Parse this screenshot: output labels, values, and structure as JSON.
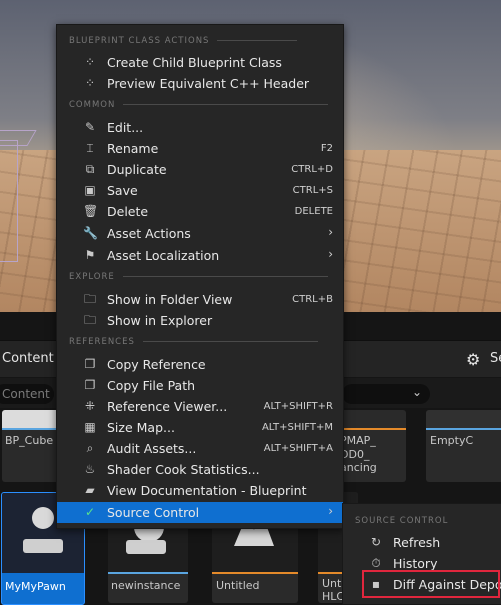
{
  "menu": {
    "sections": {
      "blueprint": "BLUEPRINT CLASS ACTIONS",
      "common": "COMMON",
      "explore": "EXPLORE",
      "references": "REFERENCES"
    },
    "items": {
      "create_child": {
        "label": "Create Child Blueprint Class",
        "icon": "blueprint-icon"
      },
      "preview_cpp": {
        "label": "Preview Equivalent C++ Header",
        "icon": "cpp-header-icon"
      },
      "edit": {
        "label": "Edit...",
        "icon": "pencil-icon"
      },
      "rename": {
        "label": "Rename",
        "shortcut": "F2",
        "icon": "rename-icon"
      },
      "duplicate": {
        "label": "Duplicate",
        "shortcut": "CTRL+D",
        "icon": "duplicate-icon"
      },
      "save": {
        "label": "Save",
        "shortcut": "CTRL+S",
        "icon": "save-icon"
      },
      "delete": {
        "label": "Delete",
        "shortcut": "DELETE",
        "icon": "trash-icon"
      },
      "asset_actions": {
        "label": "Asset Actions",
        "icon": "wrench-icon"
      },
      "asset_localization": {
        "label": "Asset Localization",
        "icon": "flag-icon"
      },
      "show_folder": {
        "label": "Show in Folder View",
        "shortcut": "CTRL+B",
        "icon": "folder-search-icon"
      },
      "show_explorer": {
        "label": "Show in Explorer",
        "icon": "folder-search-icon"
      },
      "copy_reference": {
        "label": "Copy Reference",
        "icon": "copy-icon"
      },
      "copy_file_path": {
        "label": "Copy File Path",
        "icon": "copy-icon"
      },
      "reference_viewer": {
        "label": "Reference Viewer...",
        "shortcut": "ALT+SHIFT+R",
        "icon": "reference-viewer-icon"
      },
      "size_map": {
        "label": "Size Map...",
        "shortcut": "ALT+SHIFT+M",
        "icon": "size-map-icon"
      },
      "audit_assets": {
        "label": "Audit Assets...",
        "shortcut": "ALT+SHIFT+A",
        "icon": "audit-icon"
      },
      "shader_cook": {
        "label": "Shader Cook Statistics...",
        "icon": "shader-icon"
      },
      "view_docs": {
        "label": "View Documentation - Blueprint",
        "icon": "book-icon"
      },
      "source_control": {
        "label": "Source Control",
        "icon": "source-control-icon"
      }
    }
  },
  "submenu": {
    "section": "SOURCE CONTROL",
    "refresh": "Refresh",
    "history": "History",
    "diff": "Diff Against Depot"
  },
  "content_browser": {
    "title": "Content",
    "settings_label": "Se",
    "search_placeholder": "Content",
    "assets": {
      "bp_cube": "BP_Cube",
      "mapd_line1": "PMAP_",
      "mapd_line2": "DD0_",
      "mapd_line3": "ancing",
      "emptyc": "EmptyC",
      "mypawn": "MyMyPawn",
      "newinstance": "newinstance",
      "untitled": "Untitled",
      "unt_line1": "Unt",
      "unt_line2": "HLC"
    }
  },
  "colors": {
    "highlight": "#0f6fd0",
    "source_control_icon": "#58e38c",
    "outline": "#e0263d"
  }
}
